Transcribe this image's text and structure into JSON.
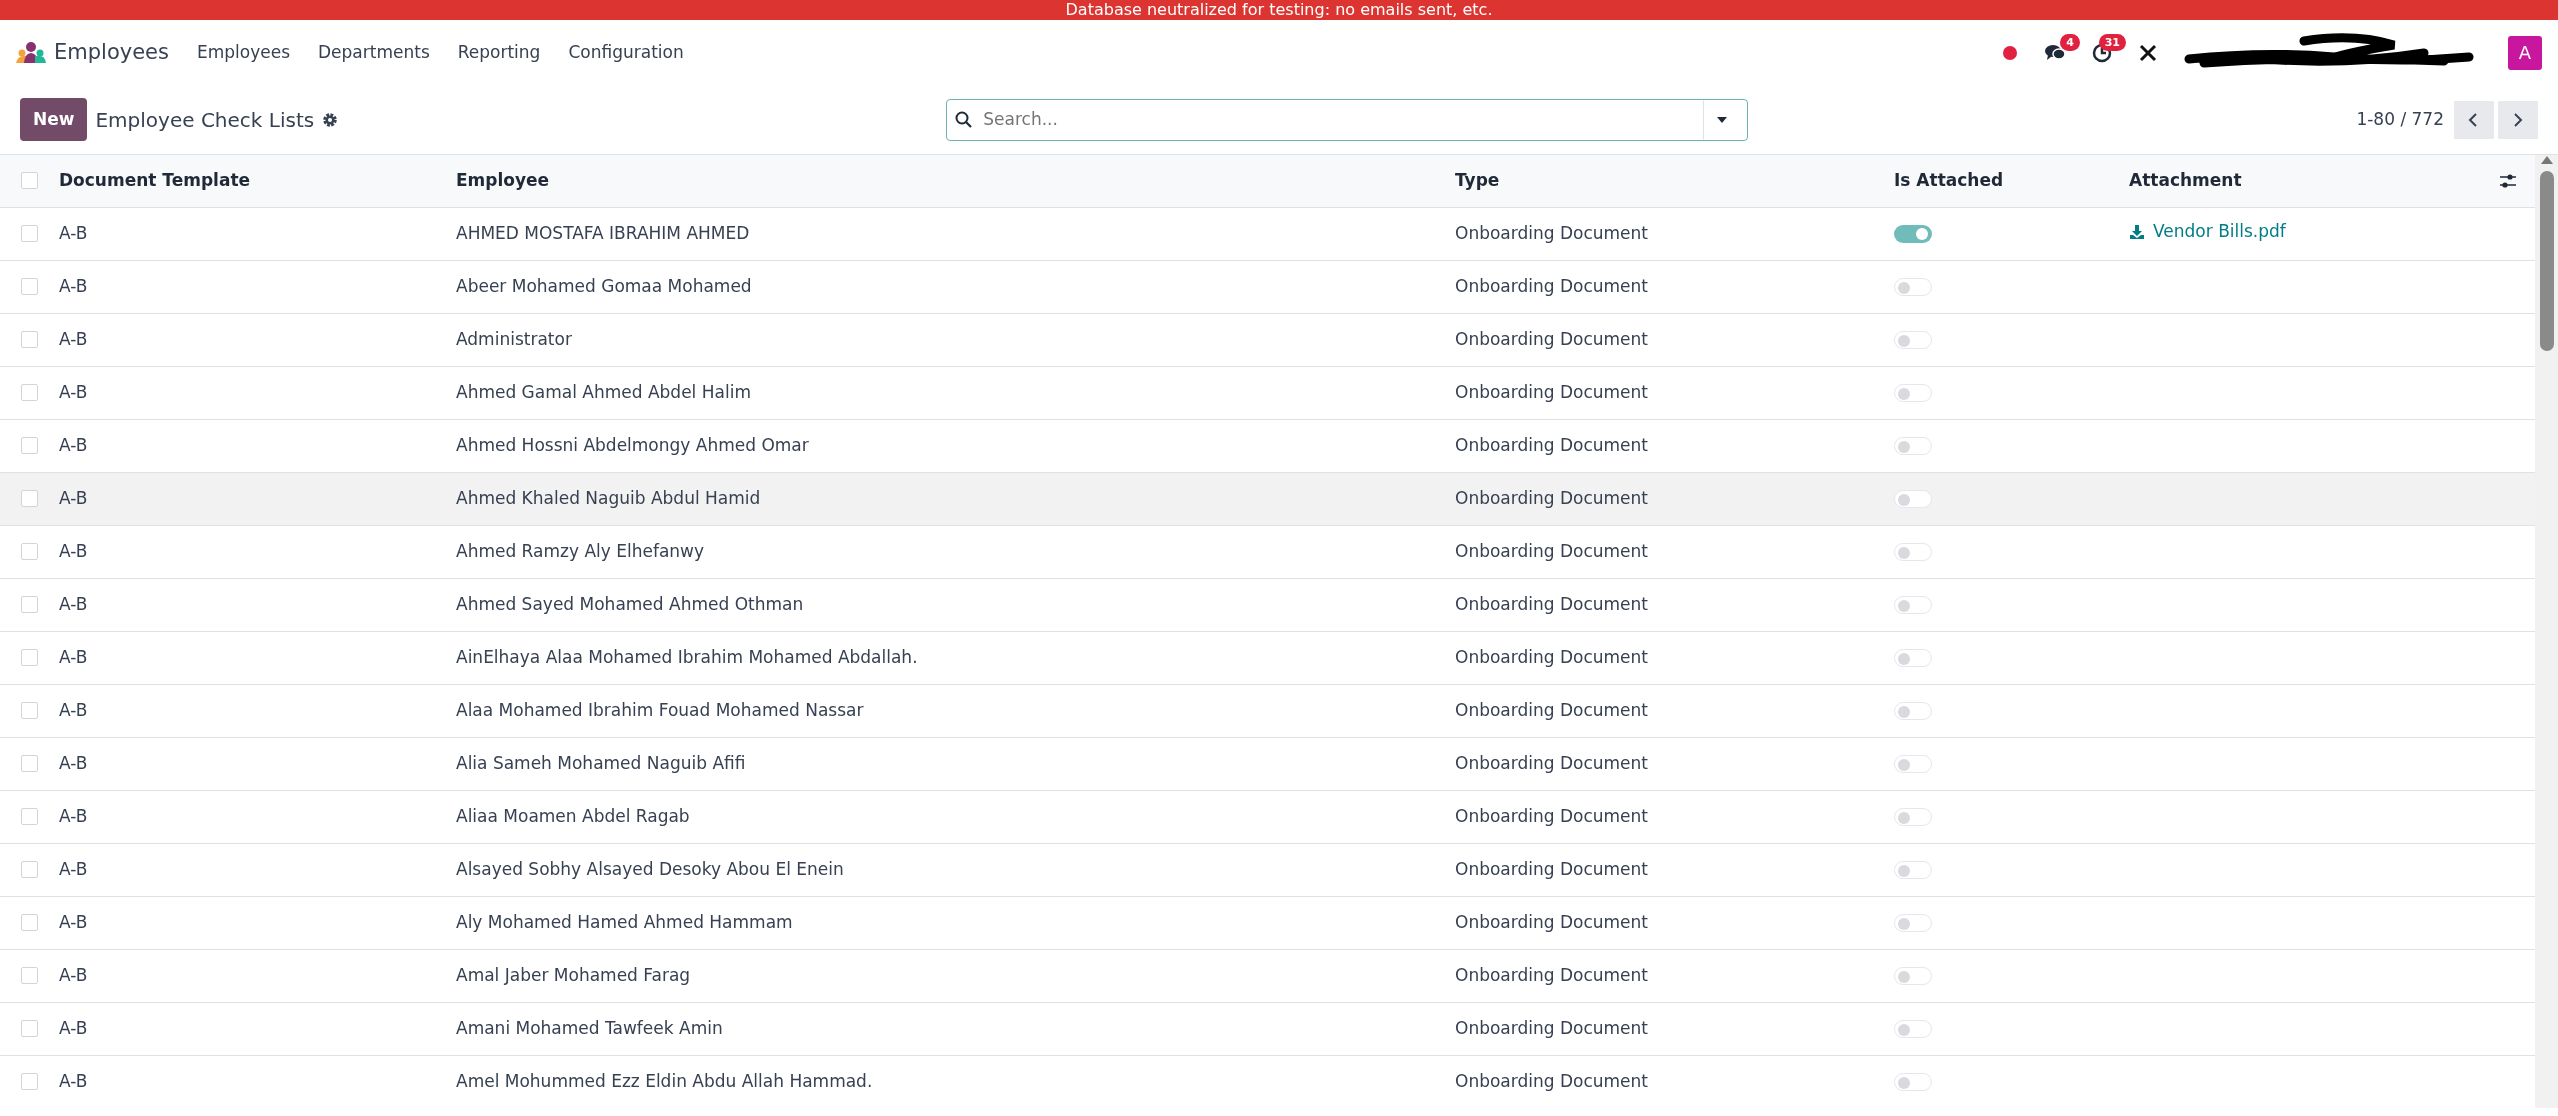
{
  "banner": "Database neutralized for testing: no emails sent, etc.",
  "navbar": {
    "app_name": "Employees",
    "menus": [
      "Employees",
      "Departments",
      "Reporting",
      "Configuration"
    ],
    "messages_count": "4",
    "activities_count": "31",
    "avatar": "A"
  },
  "control_panel": {
    "new_button": "New",
    "title": "Employee Check Lists",
    "search": {
      "placeholder": "Search..."
    },
    "pager": "1-80 / 772"
  },
  "table": {
    "all_selected": false,
    "columns": [
      "Document Template",
      "Employee",
      "Type",
      "Is Attached",
      "Attachment"
    ],
    "rows": [
      {
        "template": "A-B",
        "employee": "AHMED MOSTAFA IBRAHIM AHMED",
        "type": "Onboarding Document",
        "attached": true,
        "attachment": "Vendor Bills.pdf",
        "selected": false,
        "highlighted": false
      },
      {
        "template": "A-B",
        "employee": "Abeer Mohamed Gomaa Mohamed",
        "type": "Onboarding Document",
        "attached": false,
        "selected": false,
        "highlighted": false
      },
      {
        "template": "A-B",
        "employee": "Administrator",
        "type": "Onboarding Document",
        "attached": false,
        "selected": false,
        "highlighted": false
      },
      {
        "template": "A-B",
        "employee": "Ahmed Gamal Ahmed Abdel Halim",
        "type": "Onboarding Document",
        "attached": false,
        "selected": false,
        "highlighted": false
      },
      {
        "template": "A-B",
        "employee": "Ahmed Hossni Abdelmongy Ahmed Omar",
        "type": "Onboarding Document",
        "attached": false,
        "selected": false,
        "highlighted": false
      },
      {
        "template": "A-B",
        "employee": "Ahmed Khaled Naguib Abdul Hamid",
        "type": "Onboarding Document",
        "attached": false,
        "selected": false,
        "highlighted": true
      },
      {
        "template": "A-B",
        "employee": "Ahmed Ramzy Aly Elhefanwy",
        "type": "Onboarding Document",
        "attached": false,
        "selected": false,
        "highlighted": false
      },
      {
        "template": "A-B",
        "employee": "Ahmed Sayed Mohamed Ahmed Othman",
        "type": "Onboarding Document",
        "attached": false,
        "selected": false,
        "highlighted": false
      },
      {
        "template": "A-B",
        "employee": "AinElhaya Alaa Mohamed Ibrahim Mohamed Abdallah.",
        "type": "Onboarding Document",
        "attached": false,
        "selected": false,
        "highlighted": false
      },
      {
        "template": "A-B",
        "employee": "Alaa Mohamed Ibrahim Fouad Mohamed Nassar",
        "type": "Onboarding Document",
        "attached": false,
        "selected": false,
        "highlighted": false
      },
      {
        "template": "A-B",
        "employee": "Alia Sameh Mohamed Naguib Afifi",
        "type": "Onboarding Document",
        "attached": false,
        "selected": false,
        "highlighted": false
      },
      {
        "template": "A-B",
        "employee": "Aliaa Moamen Abdel Ragab",
        "type": "Onboarding Document",
        "attached": false,
        "selected": false,
        "highlighted": false
      },
      {
        "template": "A-B",
        "employee": "Alsayed Sobhy Alsayed Desoky Abou El Enein",
        "type": "Onboarding Document",
        "attached": false,
        "selected": false,
        "highlighted": false
      },
      {
        "template": "A-B",
        "employee": "Aly Mohamed Hamed Ahmed Hammam",
        "type": "Onboarding Document",
        "attached": false,
        "selected": false,
        "highlighted": false
      },
      {
        "template": "A-B",
        "employee": "Amal Jaber Mohamed Farag",
        "type": "Onboarding Document",
        "attached": false,
        "selected": false,
        "highlighted": false
      },
      {
        "template": "A-B",
        "employee": "Amani Mohamed Tawfeek Amin",
        "type": "Onboarding Document",
        "attached": false,
        "selected": false,
        "highlighted": false
      },
      {
        "template": "A-B",
        "employee": "Amel Mohummed Ezz Eldin Abdu Allah Hammad.",
        "type": "Onboarding Document",
        "attached": false,
        "selected": false,
        "highlighted": false
      }
    ]
  }
}
